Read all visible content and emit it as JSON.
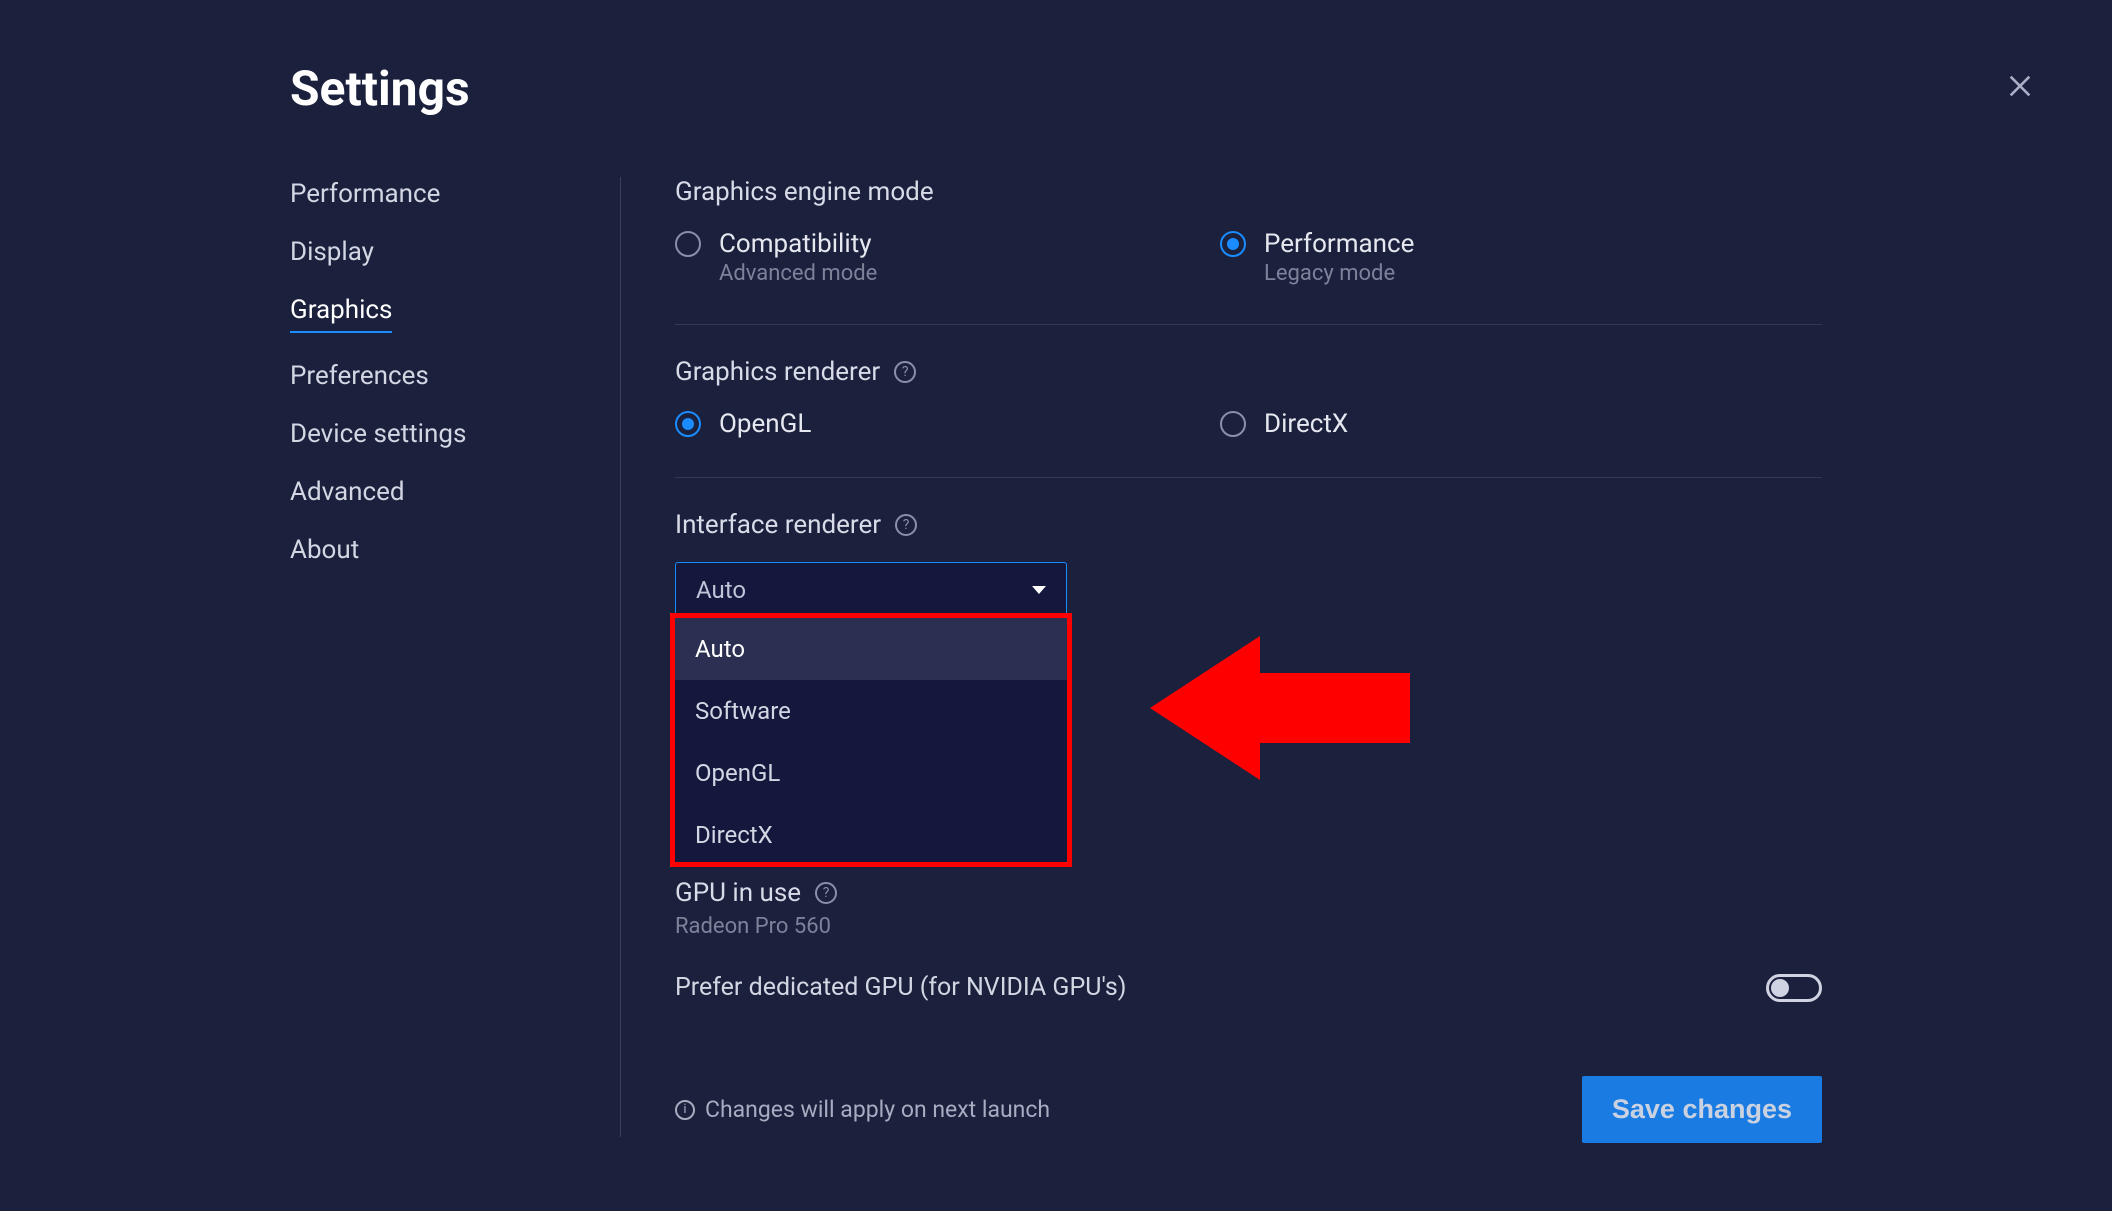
{
  "title": "Settings",
  "sidebar": {
    "items": [
      {
        "label": "Performance",
        "active": false
      },
      {
        "label": "Display",
        "active": false
      },
      {
        "label": "Graphics",
        "active": true
      },
      {
        "label": "Preferences",
        "active": false
      },
      {
        "label": "Device settings",
        "active": false
      },
      {
        "label": "Advanced",
        "active": false
      },
      {
        "label": "About",
        "active": false
      }
    ]
  },
  "engine_mode": {
    "label": "Graphics engine mode",
    "options": [
      {
        "label": "Compatibility",
        "sub": "Advanced mode",
        "selected": false
      },
      {
        "label": "Performance",
        "sub": "Legacy mode",
        "selected": true
      }
    ]
  },
  "renderer": {
    "label": "Graphics renderer",
    "options": [
      {
        "label": "OpenGL",
        "selected": true
      },
      {
        "label": "DirectX",
        "selected": false
      }
    ]
  },
  "interface": {
    "label": "Interface renderer",
    "selected": "Auto",
    "options": [
      "Auto",
      "Software",
      "OpenGL",
      "DirectX"
    ]
  },
  "gpu": {
    "label": "GPU in use",
    "value": "Radeon Pro 560",
    "prefer_label": "Prefer dedicated GPU (for NVIDIA GPU's)",
    "prefer_on": false
  },
  "footer": {
    "notice": "Changes will apply on next launch",
    "save": "Save changes"
  },
  "colors": {
    "accent": "#1a8cff",
    "highlight": "#ff0000"
  }
}
